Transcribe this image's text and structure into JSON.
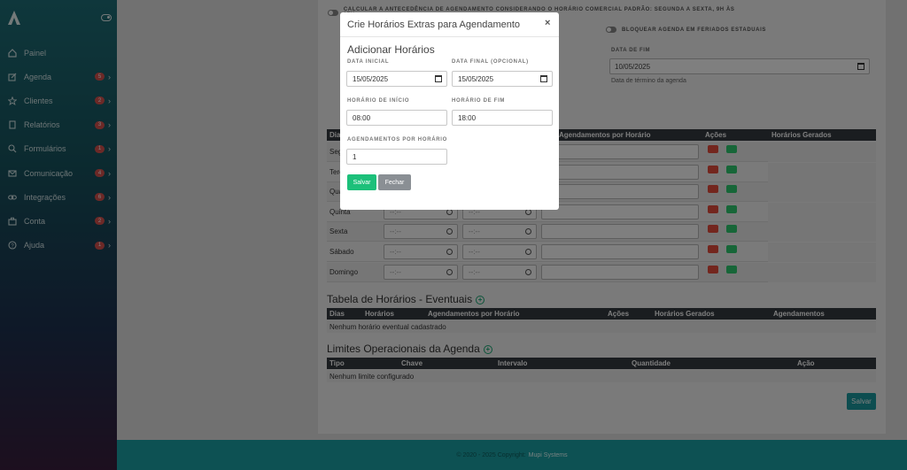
{
  "sidebar": {
    "items": [
      {
        "label": "Painel",
        "icon": "home-icon",
        "badge": null
      },
      {
        "label": "Agenda",
        "icon": "edit-icon",
        "badge": "5"
      },
      {
        "label": "Clientes",
        "icon": "star-icon",
        "badge": "2"
      },
      {
        "label": "Relatórios",
        "icon": "book-icon",
        "badge": "3"
      },
      {
        "label": "Formulários",
        "icon": "search-icon",
        "badge": "1"
      },
      {
        "label": "Comunicação",
        "icon": "mail-icon",
        "badge": "4"
      },
      {
        "label": "Integrações",
        "icon": "link-icon",
        "badge": "6"
      },
      {
        "label": "Conta",
        "icon": "briefcase-icon",
        "badge": "2"
      },
      {
        "label": "Ajuda",
        "icon": "help-icon",
        "badge": "1"
      }
    ]
  },
  "settings": {
    "calc_label": "Calcular a antecedência de agendamento considerando o horário comercial padrão: segunda a sexta, 9h às 17h",
    "block_label": "Bloquear agenda em feriados estaduais",
    "date_end_label": "DATA DE FIM",
    "date_end_value": "10/05/2025",
    "date_end_help": "Data de término da agenda"
  },
  "weekly": {
    "headers": [
      "Dias",
      "Agendamentos por Horário",
      "Ações",
      "Horários Gerados"
    ],
    "days": [
      "Segunda",
      "Terça",
      "Quarta",
      "Quinta",
      "Sexta",
      "Sábado",
      "Domingo"
    ],
    "time_placeholder": "--:--"
  },
  "eventual": {
    "title": "Tabela de Horários - Eventuais",
    "headers": [
      "Dias",
      "Horários",
      "Agendamentos por Horário",
      "Ações",
      "Horários Gerados",
      "Agendamentos"
    ],
    "empty": "Nenhum horário eventual cadastrado"
  },
  "limits": {
    "title": "Limites Operacionais da Agenda",
    "headers": [
      "Tipo",
      "Chave",
      "Intervalo",
      "Quantidade",
      "Ação"
    ],
    "empty": "Nenhum limite configurado"
  },
  "save_label": "Salvar",
  "footer": {
    "text": "© 2020 - 2025 Copyright:",
    "brand": "Mupi Systems"
  },
  "modal": {
    "title": "Crie Horários Extras para Agendamento",
    "subtitle": "Adicionar Horários",
    "start_date_label": "DATA INICIAL",
    "start_date_value": "15/05/2025",
    "end_date_label": "DATA FINAL (OPCIONAL)",
    "end_date_value": "15/05/2025",
    "start_time_label": "HORÁRIO DE INÍCIO",
    "start_time_value": "08:00",
    "end_time_label": "HORÁRIO DE FIM",
    "end_time_value": "18:00",
    "per_slot_label": "AGENDAMENTOS POR HORÁRIO",
    "per_slot_value": "1",
    "save": "Salvar",
    "close": "Fechar"
  },
  "colors": {
    "accent": "#1a9ba0",
    "save_green": "#1cc07a",
    "close_gray": "#8a8f94"
  }
}
